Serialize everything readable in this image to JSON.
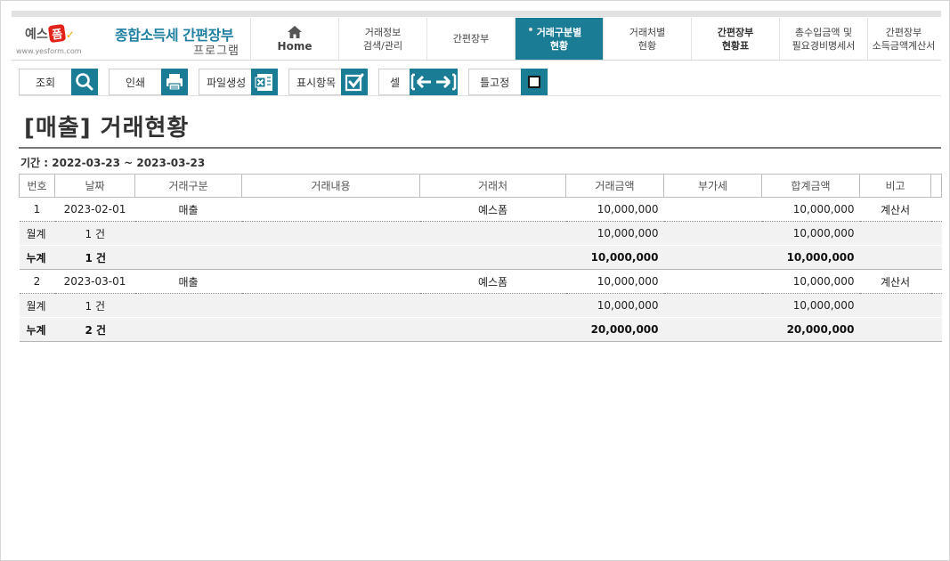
{
  "logo": {
    "brand_text": "예스",
    "badge_text": "폼",
    "url": "www.yesform.com"
  },
  "program": {
    "title": "종합소득세 간편장부",
    "subtitle": "프로그램"
  },
  "tabs": [
    {
      "line1": "Home",
      "line2": ""
    },
    {
      "line1": "거래정보",
      "line2": "검색/관리"
    },
    {
      "line1": "간편장부",
      "line2": ""
    },
    {
      "line1": "거래구분별",
      "line2": "현황"
    },
    {
      "line1": "거래처별",
      "line2": "현황"
    },
    {
      "line1": "간편장부",
      "line2": "현황표"
    },
    {
      "line1": "총수입금액 및",
      "line2": "필요경비명세서"
    },
    {
      "line1": "간편장부",
      "line2": "소득금액계산서"
    }
  ],
  "toolbar": {
    "search_label": "조회",
    "print_label": "인쇄",
    "file_label": "파일생성",
    "display_label": "표시항목",
    "cell_label": "셀",
    "freeze_label": "틀고정"
  },
  "page": {
    "title": "[매출] 거래현황",
    "period_label": "기간 :",
    "period_value": "2022-03-23 ~ 2023-03-23"
  },
  "table": {
    "headers": [
      "번호",
      "날짜",
      "거래구분",
      "거래내용",
      "거래처",
      "거래금액",
      "부가세",
      "합계금액",
      "비고"
    ],
    "groups": [
      {
        "row": {
          "no": "1",
          "date": "2023-02-01",
          "type": "매출",
          "content": "",
          "partner": "예스폼",
          "amount": "10,000,000",
          "vat": "",
          "total": "10,000,000",
          "note": "계산서"
        },
        "subtotal": {
          "label": "월계",
          "count": "1 건",
          "amount": "10,000,000",
          "total": "10,000,000"
        },
        "cumulative": {
          "label": "누계",
          "count": "1 건",
          "amount": "10,000,000",
          "total": "10,000,000"
        }
      },
      {
        "row": {
          "no": "2",
          "date": "2023-03-01",
          "type": "매출",
          "content": "",
          "partner": "예스폼",
          "amount": "10,000,000",
          "vat": "",
          "total": "10,000,000",
          "note": "계산서"
        },
        "subtotal": {
          "label": "월계",
          "count": "1 건",
          "amount": "10,000,000",
          "total": "10,000,000"
        },
        "cumulative": {
          "label": "누계",
          "count": "2 건",
          "amount": "20,000,000",
          "total": "20,000,000"
        }
      }
    ]
  },
  "colors": {
    "accent": "#1b7d95",
    "brand_title": "#1f7fa0",
    "logo_red": "#e2231a",
    "row_shade": "#f2f2f2"
  }
}
